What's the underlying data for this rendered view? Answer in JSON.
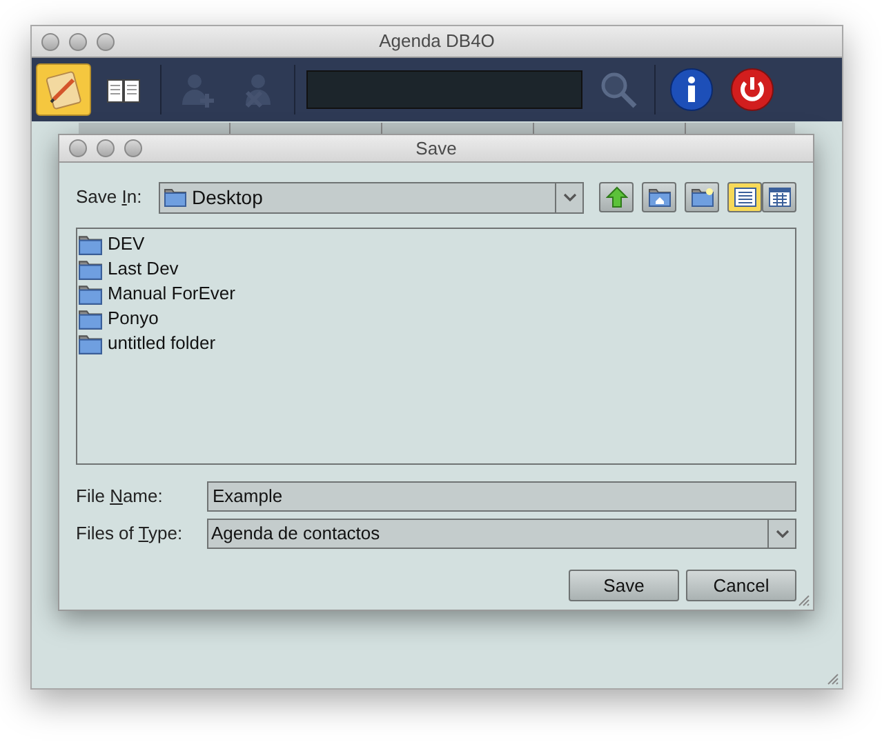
{
  "window": {
    "title": "Agenda DB4O"
  },
  "toolbar": [
    {
      "kind": "notes",
      "selected": true,
      "disabled": false
    },
    {
      "kind": "book",
      "selected": false,
      "disabled": false
    },
    {
      "kind": "add-user",
      "selected": false,
      "disabled": true
    },
    {
      "kind": "delete-user",
      "selected": false,
      "disabled": true
    },
    {
      "kind": "search-field"
    },
    {
      "kind": "search",
      "selected": false,
      "disabled": false
    },
    {
      "kind": "info",
      "selected": false,
      "disabled": false
    },
    {
      "kind": "power",
      "selected": false,
      "disabled": false
    }
  ],
  "dialog": {
    "title": "Save",
    "save_in": {
      "label": "Save In:",
      "value": "Desktop"
    },
    "nav_buttons": [
      {
        "kind": "up",
        "selected": false
      },
      {
        "kind": "home",
        "selected": false
      },
      {
        "kind": "new-folder",
        "selected": false
      },
      {
        "kind": "list",
        "selected": true
      },
      {
        "kind": "details",
        "selected": false
      }
    ],
    "files": [
      {
        "name": "DEV"
      },
      {
        "name": "Last Dev"
      },
      {
        "name": "Manual ForEver"
      },
      {
        "name": "Ponyo"
      },
      {
        "name": "untitled folder"
      }
    ],
    "file_name": {
      "label": "File Name:",
      "value": "Example"
    },
    "file_type": {
      "label": "Files of Type:",
      "value": "Agenda de contactos"
    },
    "buttons": [
      "Save",
      "Cancel"
    ]
  }
}
